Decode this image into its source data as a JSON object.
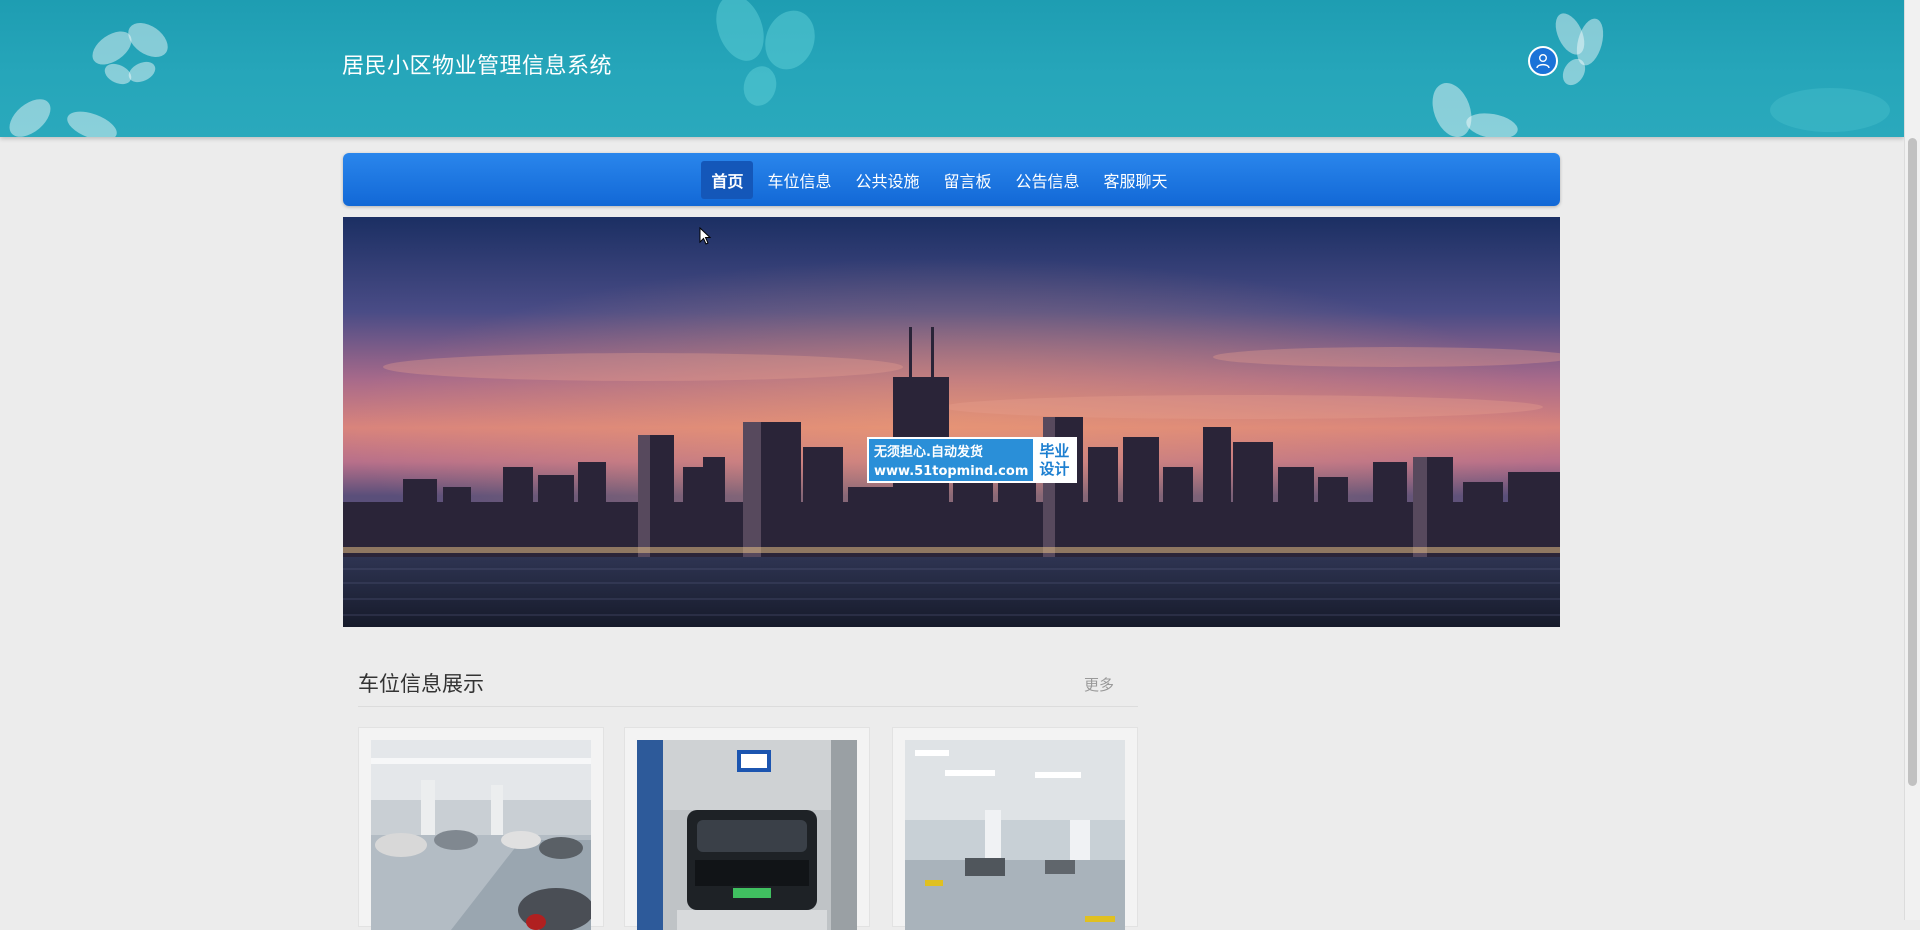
{
  "header": {
    "site_title": "居民小区物业管理信息系统",
    "user_icon": "user-icon"
  },
  "nav": {
    "items": [
      {
        "label": "首页",
        "active": true
      },
      {
        "label": "车位信息",
        "active": false
      },
      {
        "label": "公共设施",
        "active": false
      },
      {
        "label": "留言板",
        "active": false
      },
      {
        "label": "公告信息",
        "active": false
      },
      {
        "label": "客服聊天",
        "active": false
      }
    ]
  },
  "banner": {
    "image": "city-skyline-at-sunset",
    "watermark": {
      "line1": "无须担心.自动发货",
      "line2": "www.51topmind.com",
      "right_line1": "毕业",
      "right_line2": "设计"
    }
  },
  "section": {
    "title": "车位信息展示",
    "more_label": "更多",
    "cards": [
      {
        "image": "underground-parking-with-cars"
      },
      {
        "image": "black-suv-in-parking-space"
      },
      {
        "image": "empty-underground-garage"
      }
    ]
  },
  "colors": {
    "header": "#26a6ba",
    "nav": "#1a74e0",
    "nav_active": "#1457b9",
    "page_bg": "#ececec"
  }
}
